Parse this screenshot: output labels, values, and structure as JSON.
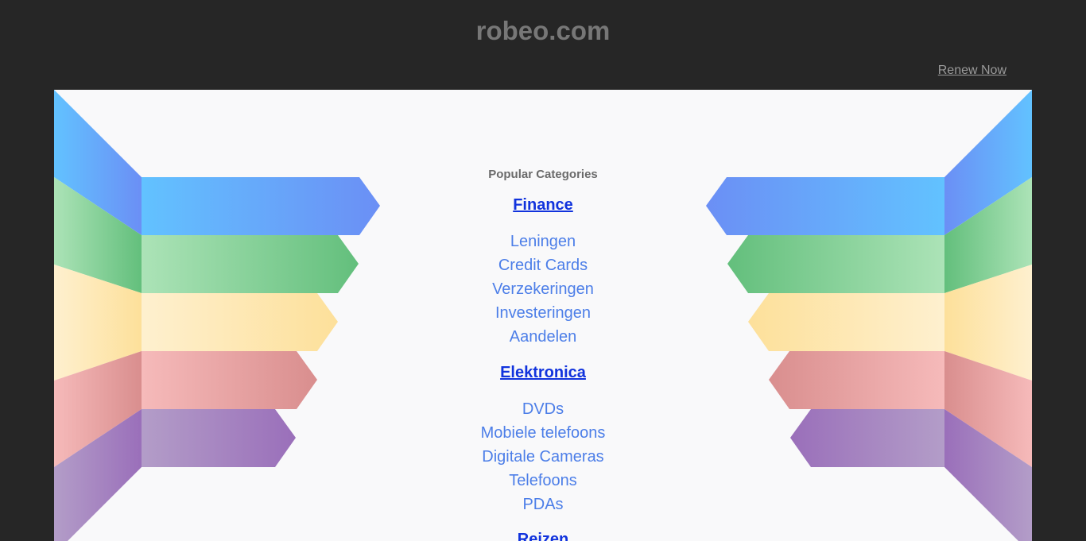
{
  "header": {
    "site_title": "robeo.com",
    "renew_label": "Renew Now"
  },
  "main": {
    "heading": "Popular Categories",
    "categories": [
      {
        "label": "Finance",
        "items": [
          "Leningen",
          "Credit Cards",
          "Verzekeringen",
          "Investeringen",
          "Aandelen"
        ]
      },
      {
        "label": "Elektronica",
        "items": [
          "DVDs",
          "Mobiele telefoons",
          "Digitale Cameras",
          "Telefoons",
          "PDAs"
        ]
      },
      {
        "label": "Reizen",
        "items": []
      }
    ]
  },
  "colors": {
    "background": "#262626",
    "panel": "#f9f9fa",
    "category_link": "#1133dd",
    "sub_link": "#4c7ee8",
    "band_blue": "#62bdfc",
    "band_green": "#6fc583",
    "band_yellow": "#fde39b",
    "band_red": "#f5b4b4",
    "band_purple": "#9c76bc"
  }
}
